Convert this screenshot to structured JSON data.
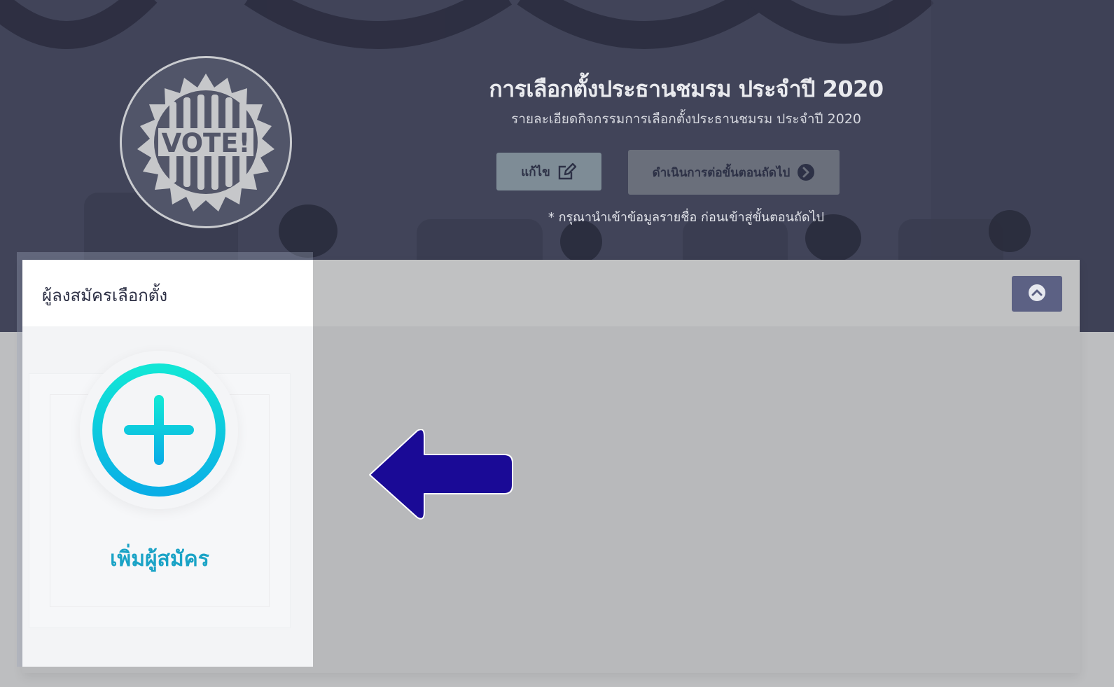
{
  "hero": {
    "title": "การเลือกตั้งประธานชมรม ประจำปี 2020",
    "subtitle": "รายละเอียดกิจกรรมการเลือกตั้งประธานชมรม ประจำปี 2020",
    "edit_button": {
      "label": "แก้ไข",
      "icon": "edit-icon"
    },
    "next_button": {
      "label": "ดำเนินการต่อขั้นตอนถัดไป",
      "icon": "chevron-right-circle-icon"
    },
    "note": "* กรุณานำเข้าข้อมูลรายชื่อ ก่อนเข้าสู่ขั้นตอนถัดไป",
    "badge_text": "VOTE!"
  },
  "panel": {
    "title": "ผู้ลงสมัครเลือกตั้ง",
    "collapse_icon": "chevron-up-circle-icon"
  },
  "add_candidate": {
    "label": "เพิ่มผู้สมัคร",
    "icon": "plus-circle-icon"
  },
  "annotation": {
    "icon": "arrow-left-icon",
    "color": "#1a0a96"
  },
  "colors": {
    "hero_bg": "#4a4d63",
    "accent_teal": "#1aa3c6",
    "button_edit": "#7e8c96",
    "button_next": "#6a6f7b",
    "collapse_button": "#5c6184"
  }
}
